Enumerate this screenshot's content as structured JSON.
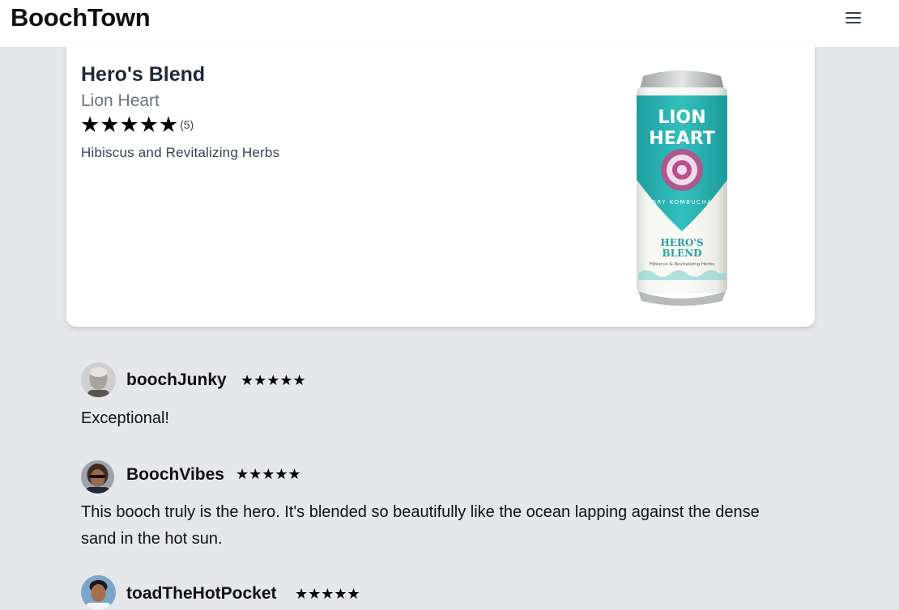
{
  "header": {
    "brand": "BoochTown",
    "menu_icon": "hamburger-menu-icon"
  },
  "product": {
    "name": "Hero's Blend",
    "brewery": "Lion Heart",
    "rating": 5,
    "rating_count": "(5)",
    "flavor": "Hibiscus and Revitalizing Herbs",
    "can_image": {
      "brand_line1": "LION",
      "brand_line2": "HEART",
      "subtitle": "DRY KOMBUCHA",
      "flavor_line1": "HERO'S",
      "flavor_line2": "BLEND",
      "flavor_sub": "Hibiscus & Revitalizing Herbs",
      "accent": "#2bb5b5"
    }
  },
  "reviews": [
    {
      "user": "boochJunky",
      "stars": "★★★★★",
      "rating": 5,
      "text": "Exceptional!"
    },
    {
      "user": "BoochVibes",
      "stars": "★★★★★",
      "rating": 5,
      "text": "This booch truly is the hero. It's blended so beautifully like the ocean lapping against the dense sand in the hot sun."
    },
    {
      "user": "toadTheHotPocket",
      "stars": "★★★★★",
      "rating": 5,
      "text": ""
    }
  ]
}
